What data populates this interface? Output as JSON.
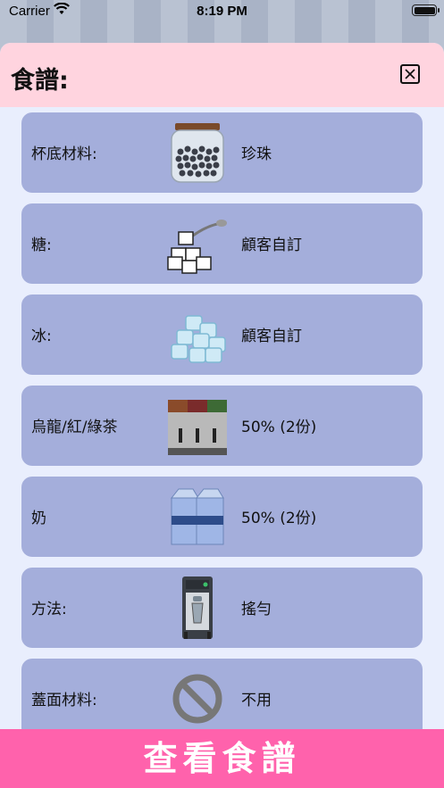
{
  "status_bar": {
    "carrier": "Carrier",
    "time": "8:19 PM",
    "battery": "full-battery-icon",
    "wifi": "wifi-icon"
  },
  "header": {
    "title": "食譜:",
    "close_icon": "close-icon"
  },
  "recipe_items": [
    {
      "label": "杯底材料:",
      "icon": "pearl-jar-icon",
      "value": "珍珠"
    },
    {
      "label": "糖:",
      "icon": "sugar-cubes-icon",
      "value": "顧客自訂"
    },
    {
      "label": "冰:",
      "icon": "ice-cubes-icon",
      "value": "顧客自訂"
    },
    {
      "label": "烏龍/紅/綠茶",
      "icon": "tea-dispenser-icon",
      "value": "50% (2份)"
    },
    {
      "label": "奶",
      "icon": "milk-cartons-icon",
      "value": "50% (2份)"
    },
    {
      "label": "方法:",
      "icon": "shaker-machine-icon",
      "value": "搖勻"
    },
    {
      "label": "蓋面材料:",
      "icon": "no-sign-icon",
      "value": "不用"
    }
  ],
  "bottom_button": {
    "label": "查看食譜"
  }
}
